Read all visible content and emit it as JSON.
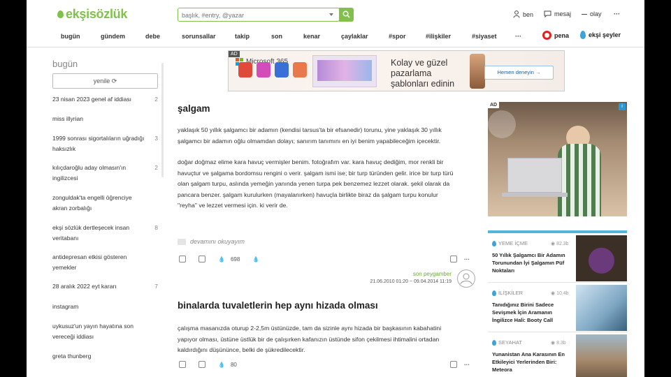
{
  "header": {
    "logo": "ekşisözlük",
    "search_placeholder": "başlık, #entry, @yazar",
    "user_actions": [
      "ben",
      "mesaj",
      "olay"
    ],
    "more": "···"
  },
  "nav": {
    "items": [
      "bugün",
      "gündem",
      "debe",
      "sorunsallar",
      "takip",
      "son",
      "kenar",
      "çaylaklar",
      "#spor",
      "#ilişkiler",
      "#siyaset",
      "···"
    ],
    "pena": "pena",
    "eksi_seyler": "ekşi şeyler"
  },
  "sidebar": {
    "title": "bugün",
    "refresh": "yenile",
    "topics": [
      {
        "title": "23 nisan 2023 genel af iddiası",
        "count": "2"
      },
      {
        "title": "miss illyrian",
        "count": ""
      },
      {
        "title": "1999 sonrası sigortalıların uğradığı haksızlık",
        "count": "3"
      },
      {
        "title": "kılıçdaroğlu aday olmasın'ın ingilizcesi",
        "count": "2"
      },
      {
        "title": "zonguldak'ta engelli öğrenciye akran zorbalığı",
        "count": ""
      },
      {
        "title": "ekşi sözlük dertleşecek insan veritabanı",
        "count": "8"
      },
      {
        "title": "antidepresan etkisi gösteren yemekler",
        "count": ""
      },
      {
        "title": "28 aralık 2022 eyt kararı",
        "count": "7"
      },
      {
        "title": "instagram",
        "count": ""
      },
      {
        "title": "uykusuz'un yayın hayatına son vereceği iddiası",
        "count": ""
      },
      {
        "title": "greta thunberg",
        "count": ""
      }
    ]
  },
  "top_ad": {
    "tag": "AD",
    "brand": "Microsoft 365",
    "headline": "Kolay ve güzel pazarlama şablonları edinin",
    "cta": "Hemen deneyin →"
  },
  "entries": [
    {
      "title": "şalgam",
      "paragraphs": [
        "yaklaşık 50 yıllık şalgamcı bir adamın (kendisi tarsus'ta bir efsanedir) torunu, yine yaklaşık 30 yıllık şalgamcı bir adamın oğlu olmamdan dolayı; sanırım tanımını en iyi benim yapabileceğim içecektir.",
        "doğar doğmaz elime kara havuç vermişler benim. fotoğrafım var. kara havuç dediğim, mor renkli bir havuçtur ve şalgama bordomsu rengini o verir. şalgam ismi ise; bir turp türünden gelir. irice bir turp türü olan şalgam turpu, aslında yemeğin yanında yenen turpa pek benzemez lezzet olarak. şekil olarak da pancara benzer. şalgam kurulurken (mayalanırken) havuçla birlikte biraz da şalgam turpu konulur \"reyha\" ve lezzet vermesi için. ki verir de."
      ],
      "more": "devamını okuyayım",
      "fav_count": "698",
      "author": "son peygamber",
      "date": "21.06.2010 01:20 ~ 09.04.2014 11:19"
    },
    {
      "title": "binalarda tuvaletlerin hep aynı hizada olması",
      "paragraphs": [
        "çalışma masanızda oturup 2-2,5m üstünüzde, tam da sizinle aynı hizada bir başkasının kabahatini yapıyor olması, üstüne üstlük bir de çalışırken kafanızın üstünde sifon çekilmesi ihtimalini ortadan kaldırdığını düşününce, belki de şükredilecektir."
      ],
      "fav_count": "80"
    }
  ],
  "right_ad": {
    "tag": "AD"
  },
  "promos": [
    {
      "category": "YEME İÇME",
      "views": "82.3b",
      "title": "50 Yıllık Şalgamcı Bir Adamın Torunundan İyi Şalgamın Püf Noktaları"
    },
    {
      "category": "İLİŞKİLER",
      "views": "10.4b",
      "title": "Tanıdığınız Birini Sadece Sevişmek İçin Aramanın İngilizce Hali: Booty Call"
    },
    {
      "category": "SEYAHAT",
      "views": "8.3b",
      "title": "Yunanistan Ana Karasının En Etkileyici Yerlerinden Biri: Meteora"
    }
  ],
  "colors": {
    "brand": "#81c14b",
    "accent_blue": "#3ba5d9",
    "pena_red": "#e2211c"
  }
}
